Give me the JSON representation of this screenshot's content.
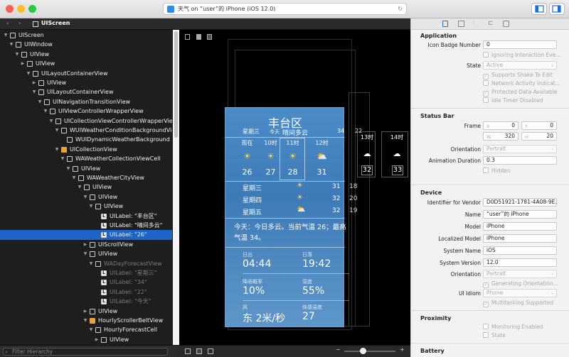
{
  "window": {
    "address": "天气 on “user”的 iPhone (iOS 12.0)"
  },
  "colors": {
    "selection": "#1c64c8",
    "red": "#fc5f57",
    "yellow": "#fdbc2e",
    "green": "#28c840"
  },
  "nav": {
    "crumb": "UIScreen"
  },
  "tree": [
    {
      "label": "UIScreen"
    },
    {
      "label": "UIWindow"
    },
    {
      "label": "UIView"
    },
    {
      "label": "UIView"
    },
    {
      "label": "UILayoutContainerView"
    },
    {
      "label": "UIView"
    },
    {
      "label": "UILayoutContainerView"
    },
    {
      "label": "UINavigationTransitionView"
    },
    {
      "label": "UIViewControllerWrapperView"
    },
    {
      "label": "UICollectionViewControllerWrapperView"
    },
    {
      "label": "WUIWeatherConditionBackgroundView"
    },
    {
      "label": "WUIDynamicWeatherBackground"
    },
    {
      "label": "UICollectionView"
    },
    {
      "label": "WAWeatherCollectionViewCell"
    },
    {
      "label": "UIView"
    },
    {
      "label": "WAWeatherCityView"
    },
    {
      "label": "UIView"
    },
    {
      "label": "UIView"
    },
    {
      "label": "UIView"
    },
    {
      "label": "UILabel: \"丰台区\""
    },
    {
      "label": "UILabel: \"晴间多云\""
    },
    {
      "label": "UILabel: \"26\""
    },
    {
      "label": "UIScrollView"
    },
    {
      "label": "UIView"
    },
    {
      "label": "WADayForecastView"
    },
    {
      "label": "UILabel: \"星期三\""
    },
    {
      "label": "UILabel: \"34\""
    },
    {
      "label": "UILabel: \"22\""
    },
    {
      "label": "UILabel: \"今天\""
    },
    {
      "label": "UIView"
    },
    {
      "label": "HourlyScrollerBeltView"
    },
    {
      "label": "HourlyForecastCell"
    },
    {
      "label": "UIView"
    }
  ],
  "filter": {
    "placeholder": "Filter Hierarchy"
  },
  "weather": {
    "city": "丰台区",
    "day": "星期三",
    "today": "今天",
    "condition": "晴间多云",
    "hi": "34",
    "lo": "22",
    "hours": [
      {
        "time": "现在",
        "temp": "26"
      },
      {
        "time": "10时",
        "temp": "27"
      },
      {
        "time": "11时",
        "temp": "28"
      },
      {
        "time": "12时",
        "temp": "31"
      },
      {
        "time": "13时",
        "temp": "32"
      },
      {
        "time": "14时",
        "temp": "33"
      }
    ],
    "days": [
      {
        "name": "星期三",
        "hi": "31",
        "lo": "18"
      },
      {
        "name": "星期四",
        "hi": "32",
        "lo": "20"
      },
      {
        "name": "星期五",
        "hi": "32",
        "lo": "19"
      }
    ],
    "summary": "今天：今日多云。当前气温 26；最高气温 34。",
    "details": [
      {
        "label": "日出",
        "value": "04:44"
      },
      {
        "label": "日落",
        "value": "19:42"
      },
      {
        "label": "降雨概率",
        "value": "10%"
      },
      {
        "label": "湿度",
        "value": "55%"
      },
      {
        "label": "风",
        "value": "东 2米/秒"
      },
      {
        "label": "体感温度",
        "value": "27"
      }
    ]
  },
  "inspector": {
    "application": {
      "title": "Application",
      "badge_label": "Icon Badge Number",
      "badge_value": "0",
      "ignoring": "Ignoring Interaction Eve...",
      "state_label": "State",
      "state_value": "Active",
      "shake": "Supports Shake To Edit",
      "network": "Network Activity Indicat...",
      "protected": "Protected Data Available",
      "idle": "Idle Timer Disabled"
    },
    "status_bar": {
      "title": "Status Bar",
      "frame_label": "Frame",
      "x_label": "X",
      "x": "0",
      "y_label": "Y",
      "y": "0",
      "w_label": "W",
      "w": "320",
      "h_label": "H",
      "h": "20",
      "orientation_label": "Orientation",
      "orientation": "Portrait",
      "duration_label": "Animation Duration",
      "duration": "0.3",
      "hidden": "Hidden"
    },
    "device": {
      "title": "Device",
      "vendor_label": "Identifier for Vendor",
      "vendor": "D0D51921-1781-4A08-9E...",
      "name_label": "Name",
      "name": "“user”的 iPhone",
      "model_label": "Model",
      "model": "iPhone",
      "lmodel_label": "Localized Model",
      "lmodel": "iPhone",
      "sysname_label": "System Name",
      "sysname": "iOS",
      "sysver_label": "System Version",
      "sysver": "12.0",
      "orientation_label": "Orientation",
      "orientation": "Portrait",
      "gen": "Generating Orientation...",
      "idiom_label": "UI Idiom",
      "idiom": "Phone",
      "multi": "Multitasking Supported"
    },
    "proximity": {
      "title": "Proximity",
      "monitor": "Monitoring Enabled",
      "state": "State"
    },
    "battery": {
      "title": "Battery"
    }
  }
}
